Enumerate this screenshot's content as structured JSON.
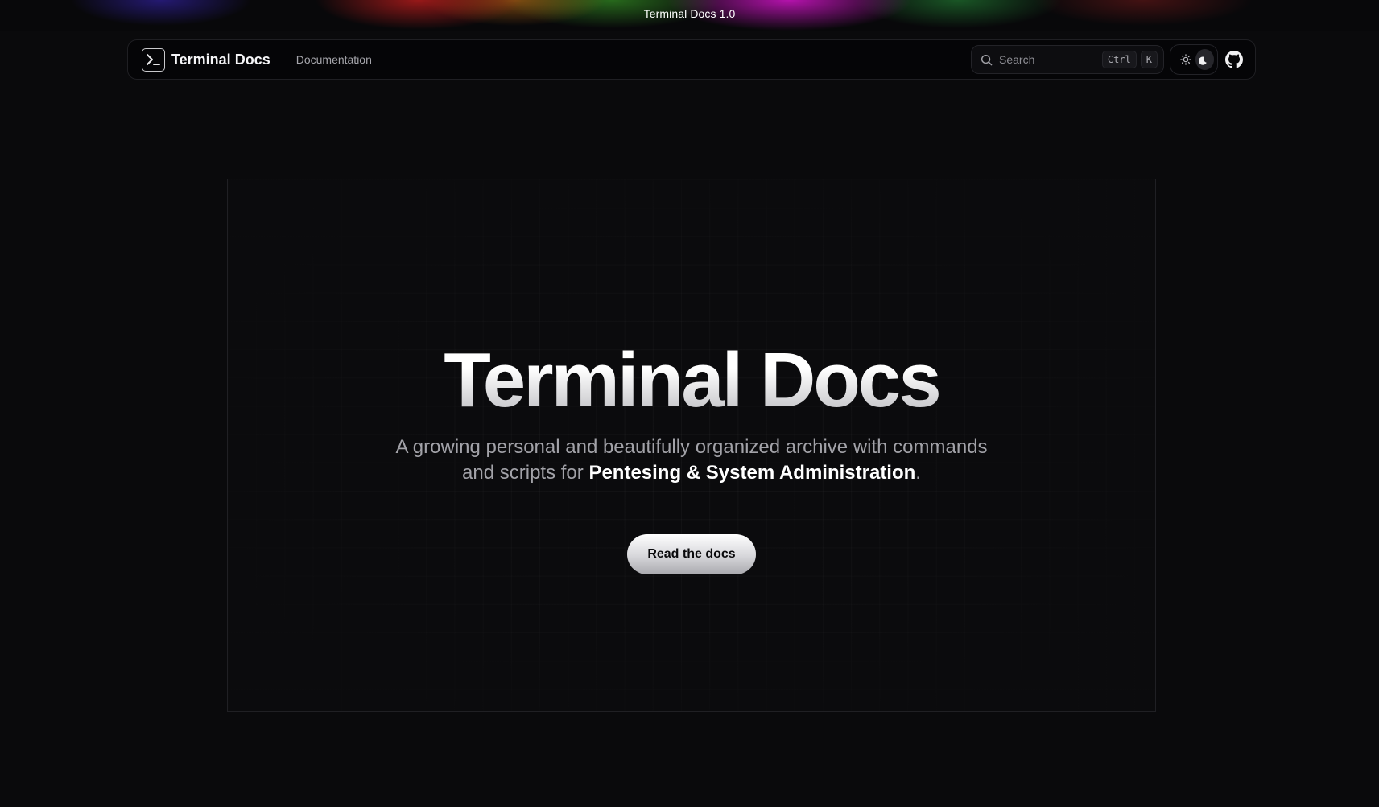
{
  "banner": {
    "text": "Terminal Docs 1.0"
  },
  "navbar": {
    "brand": "Terminal Docs",
    "links": [
      "Documentation"
    ],
    "search": {
      "placeholder": "Search",
      "shortcut_keys": [
        "Ctrl",
        "K"
      ]
    },
    "theme": {
      "options": [
        "light",
        "dark"
      ],
      "selected": "dark"
    },
    "icons": {
      "logo": "terminal-prompt-icon",
      "search": "search-icon",
      "light": "sun-icon",
      "dark": "moon-icon",
      "repo": "github-icon"
    }
  },
  "hero": {
    "title": "Terminal Docs",
    "subtitle_prefix": "A growing personal and beautifully organized archive with commands and scripts for ",
    "subtitle_highlight": "Pentesing & System Administration",
    "subtitle_suffix": ".",
    "cta_label": "Read the docs"
  },
  "colors": {
    "background": "#0a0a0c",
    "text": "#e6e6e8",
    "muted": "#a2a2a8",
    "border": "#202024"
  }
}
